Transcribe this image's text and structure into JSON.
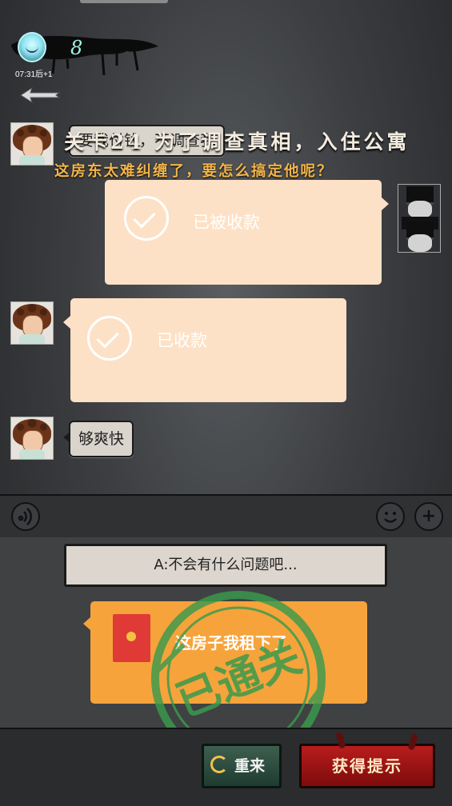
{
  "hud": {
    "lives_count": "8",
    "timer_text": "07:31后+1"
  },
  "level": {
    "title": "关卡24 为了调查真相，入住公寓",
    "subtitle": "这房东太难纠缠了，要怎么搞定他呢？"
  },
  "chat": {
    "messages": [
      {
        "sender": "landlady",
        "type": "text",
        "text": "要我付钱，不调查我"
      },
      {
        "sender": "player",
        "type": "transfer",
        "status": "已被收款"
      },
      {
        "sender": "landlady",
        "type": "transfer",
        "status": "已收款"
      },
      {
        "sender": "landlady",
        "type": "text",
        "text": "够爽快"
      }
    ]
  },
  "input_bar": {
    "voice_icon": "voice-icon",
    "emoji_icon": "emoji-icon",
    "plus_icon": "plus-icon"
  },
  "choices": {
    "option_a": "A:不会有什么问题吧...",
    "option_b": "这房子我租下了"
  },
  "stamp": {
    "text": "已通关",
    "color": "#3a9a4c"
  },
  "buttons": {
    "restart_label": "重来",
    "hint_label": "获得提示"
  },
  "colors": {
    "transfer_bubble": "#fde1c6",
    "choice_highlight": "#f6a33c",
    "hint_button": "#b81d1d",
    "subtitle": "#f3b54a"
  }
}
